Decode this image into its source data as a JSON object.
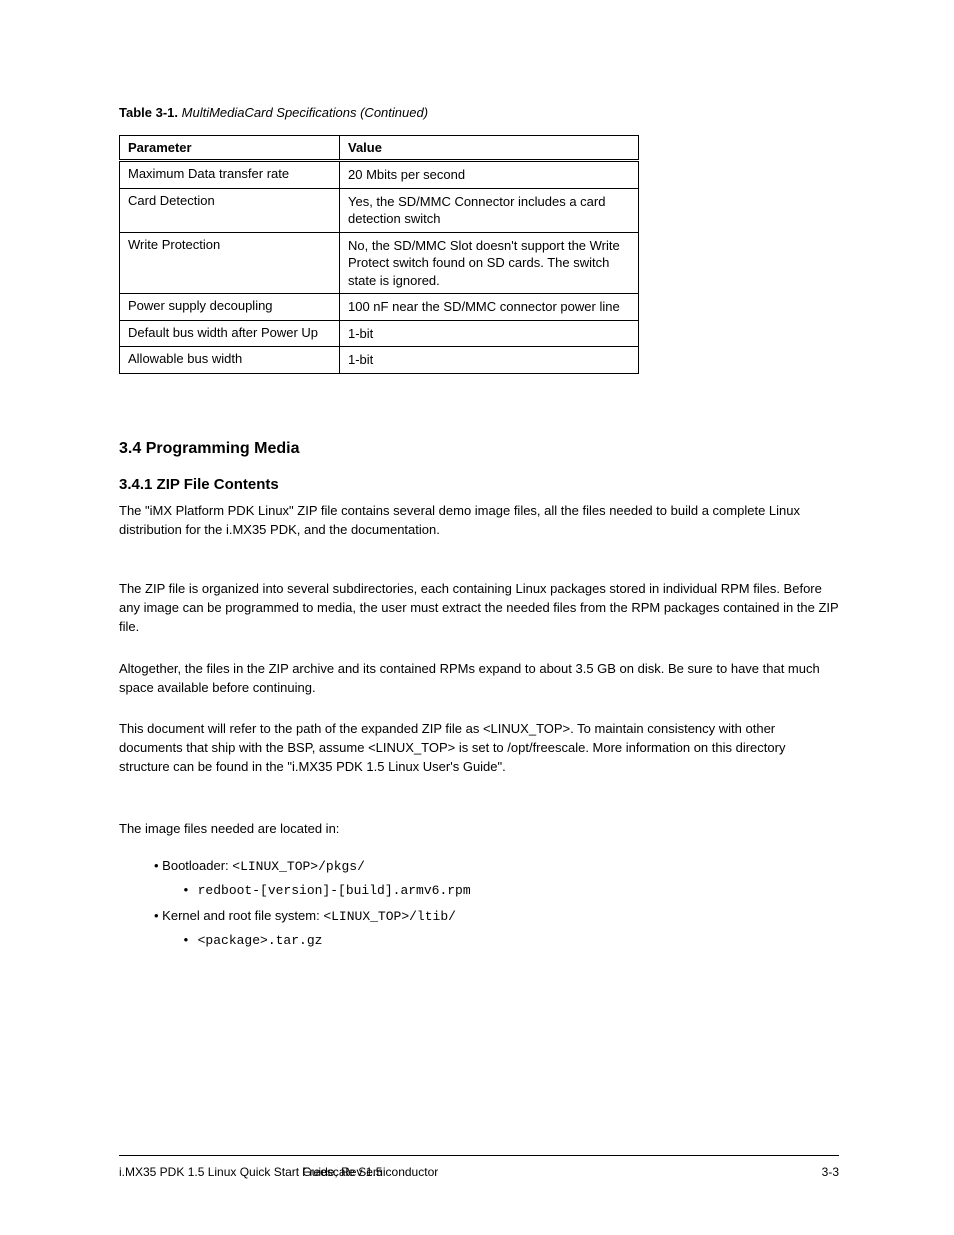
{
  "table": {
    "caption_label": "Table 3-1.",
    "caption_text": "MultiMediaCard Specifications (Continued)",
    "header": [
      "Parameter",
      "Value"
    ],
    "rows": [
      {
        "param": "Maximum Data transfer rate",
        "value": "20 Mbits per second"
      },
      {
        "param": "Card Detection",
        "value": "Yes, the SD/MMC Connector includes a card detection switch"
      },
      {
        "param": "Write Protection",
        "value": "No, the SD/MMC Slot doesn't support the Write Protect switch found on SD cards. The switch state is ignored."
      },
      {
        "param": "Power supply decoupling",
        "value": "100 nF near the SD/MMC connector power line"
      },
      {
        "param": "Default bus width after Power Up",
        "value": "1-bit"
      },
      {
        "param": "Allowable bus width",
        "value": "1-bit"
      }
    ]
  },
  "sections": {
    "media_title": "3.4 Programming Media",
    "zip_title": "3.4.1 ZIP File Contents",
    "para1": "The \"iMX Platform PDK Linux\" ZIP file contains several demo image files, all the files needed to build a complete Linux distribution for the i.MX35 PDK, and the documentation.",
    "para2": "The ZIP file is organized into several subdirectories, each containing Linux packages stored in individual RPM files. Before any image can be programmed to media, the user must extract the needed files from the RPM packages contained in the ZIP file.",
    "para3": "Altogether, the files in the ZIP archive and its contained RPMs expand to about 3.5 GB on disk. Be sure to have that much space available before continuing.",
    "para4": "This document will refer to the path of the expanded ZIP file as <LINUX_TOP>. To maintain consistency with other documents that ship with the BSP, assume <LINUX_TOP> is set to /opt/freescale. More information on this directory structure can be found in the \"i.MX35 PDK 1.5 Linux User's Guide\".",
    "para5": "The image files needed are located in:",
    "list": [
      {
        "text_prefix": "Bootloader: ",
        "text_path": "<LINUX_TOP>/pkgs/",
        "sub": [
          "redboot-[version]-[build].armv6.rpm"
        ]
      },
      {
        "text_prefix": "Kernel and root file system: ",
        "text_path": "<LINUX_TOP>/ltib/",
        "sub": [
          "<package>.tar.gz"
        ]
      }
    ]
  },
  "footer": {
    "left": "i.MX35 PDK 1.5 Linux Quick Start Guide, Rev 1.5",
    "right_1": "Freescale Semiconductor",
    "right_2": "3-3"
  }
}
